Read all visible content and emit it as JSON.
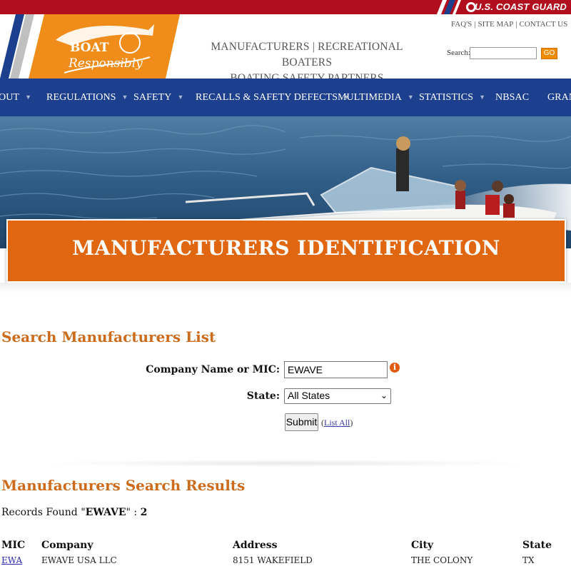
{
  "agency": {
    "name": "U.S. COAST GUARD"
  },
  "logo": {
    "line1": "BOAT",
    "line2": "Responsibly"
  },
  "top_links": [
    "FAQ'S",
    "SITE MAP",
    "CONTACT US"
  ],
  "tagline": {
    "link1": "MANUFACTURERS",
    "link2": "RECREATIONAL BOATERS",
    "link3": "BOATING SAFETY PARTNERS"
  },
  "search": {
    "label": "Search:",
    "value": "",
    "button": "GO"
  },
  "nav": [
    {
      "label": "OUT",
      "caret": true
    },
    {
      "label": "REGULATIONS",
      "caret": true
    },
    {
      "label": "SAFETY",
      "caret": true
    },
    {
      "label": "RECALLS & SAFETY DEFECTS",
      "caret": true
    },
    {
      "label": "MULTIMEDIA",
      "caret": true
    },
    {
      "label": "STATISTICS",
      "caret": true
    },
    {
      "label": "NBSAC",
      "caret": false
    },
    {
      "label": "GRANT",
      "caret": false
    }
  ],
  "banner": {
    "title": "MANUFACTURERS IDENTIFICATION"
  },
  "search_form": {
    "heading": "Search Manufacturers List",
    "company_label": "Company Name or MIC:",
    "company_value": "EWAVE",
    "info_icon": "i",
    "state_label": "State:",
    "state_value": "All States",
    "submit_label": "Submit",
    "list_all_label": "List All"
  },
  "results": {
    "heading": "Manufacturers Search Results",
    "records_prefix": "Records Found \"",
    "records_query": "EWAVE",
    "records_suffix": "\" : ",
    "records_count": "2",
    "columns": [
      "MIC",
      "Company",
      "Address",
      "City",
      "State"
    ],
    "rows": [
      {
        "mic": "EWA",
        "company": "EWAVE USA LLC",
        "address": "8151 WAKEFIELD",
        "city": "THE COLONY",
        "state": "TX"
      }
    ]
  },
  "colors": {
    "nav_blue": "#1c3f8e",
    "orange": "#e0670f",
    "heading_orange": "#cc6b1c",
    "uscg_red": "#b10f1e"
  }
}
